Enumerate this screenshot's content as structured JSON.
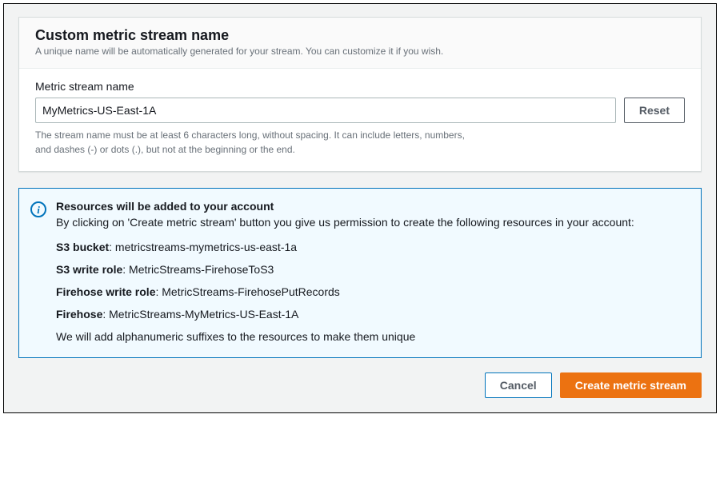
{
  "header": {
    "title": "Custom metric stream name",
    "description": "A unique name will be automatically generated for your stream. You can customize it if you wish."
  },
  "form": {
    "label": "Metric stream name",
    "value": "MyMetrics-US-East-1A",
    "reset_label": "Reset",
    "hint_line1": "The stream name must be at least 6 characters long, without spacing. It can include letters, numbers,",
    "hint_line2": "and dashes (-) or dots (.), but not at the beginning or the end."
  },
  "info": {
    "title": "Resources will be added to your account",
    "intro": "By clicking on 'Create metric stream' button you give us permission to create the following resources in your account:",
    "resources": [
      {
        "label": "S3 bucket",
        "value": "metricstreams-mymetrics-us-east-1a"
      },
      {
        "label": "S3 write role",
        "value": "MetricStreams-FirehoseToS3"
      },
      {
        "label": "Firehose write role",
        "value": "MetricStreams-FirehosePutRecords"
      },
      {
        "label": "Firehose",
        "value": "MetricStreams-MyMetrics-US-East-1A"
      }
    ],
    "suffix_note": "We will add alphanumeric suffixes to the resources to make them unique"
  },
  "footer": {
    "cancel_label": "Cancel",
    "create_label": "Create metric stream"
  }
}
